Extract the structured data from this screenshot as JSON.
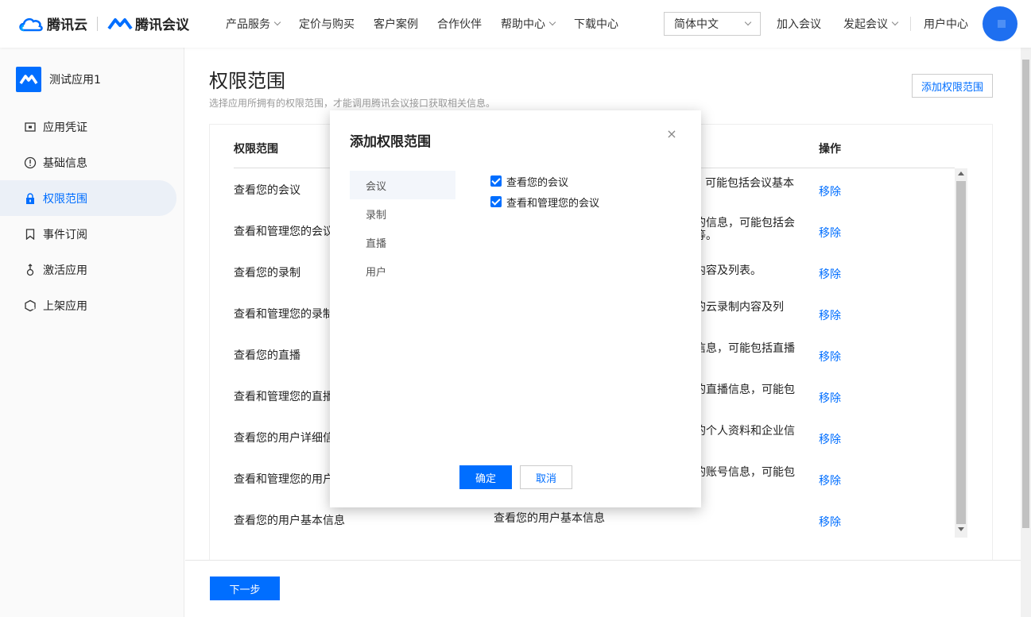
{
  "header": {
    "brand_cloud": "腾讯云",
    "brand_meeting": "腾讯会议",
    "nav": [
      "产品服务",
      "定价与购买",
      "客户案例",
      "合作伙伴",
      "帮助中心",
      "下载中心"
    ],
    "lang_value": "简体中文",
    "join_meeting": "加入会议",
    "start_meeting": "发起会议",
    "user_center": "用户中心"
  },
  "sidebar": {
    "app_name": "测试应用1",
    "items": [
      {
        "label": "应用凭证",
        "icon": "credential-icon"
      },
      {
        "label": "基础信息",
        "icon": "info-icon"
      },
      {
        "label": "权限范围",
        "icon": "lock-icon"
      },
      {
        "label": "事件订阅",
        "icon": "bookmark-icon"
      },
      {
        "label": "激活应用",
        "icon": "activate-icon"
      },
      {
        "label": "上架应用",
        "icon": "publish-icon"
      }
    ]
  },
  "main": {
    "title": "权限范围",
    "subtitle": "选择应用所拥有的权限范围，才能调用腾讯会议接口获取相关信息。",
    "add_button": "添加权限范围",
    "columns": [
      "权限范围",
      "操作"
    ],
    "rows": [
      {
        "name": "查看您的会议",
        "desc": "可能包括会议基本",
        "action": "移除"
      },
      {
        "name": "查看和管理您的会议",
        "desc": "的信息，可能包括会\n等。",
        "action": "移除"
      },
      {
        "name": "查看您的录制",
        "desc": "内容及列表。",
        "action": "移除"
      },
      {
        "name": "查看和管理您的录制",
        "desc": "的云录制内容及列",
        "action": "移除"
      },
      {
        "name": "查看您的直播",
        "desc": "信息，可能包括直播",
        "action": "移除"
      },
      {
        "name": "查看和管理您的直播",
        "desc": "的直播信息，可能包",
        "action": "移除"
      },
      {
        "name": "查看您的用户详细信",
        "desc": "的个人资料和企业信",
        "action": "移除"
      },
      {
        "name": "查看和管理您的用户",
        "desc": "的账号信息，可能包",
        "action": "移除"
      },
      {
        "name": "查看您的用户基本信息",
        "desc": "查看您的用户基本信息",
        "action": "移除"
      }
    ],
    "next_button": "下一步"
  },
  "modal": {
    "title": "添加权限范围",
    "close": "×",
    "categories": [
      "会议",
      "录制",
      "直播",
      "用户"
    ],
    "permissions": [
      {
        "label": "查看您的会议",
        "checked": true
      },
      {
        "label": "查看和管理您的会议",
        "checked": true
      }
    ],
    "ok": "确定",
    "cancel": "取消"
  },
  "colors": {
    "accent": "#006eff",
    "active_bg": "#ebf0f7"
  }
}
